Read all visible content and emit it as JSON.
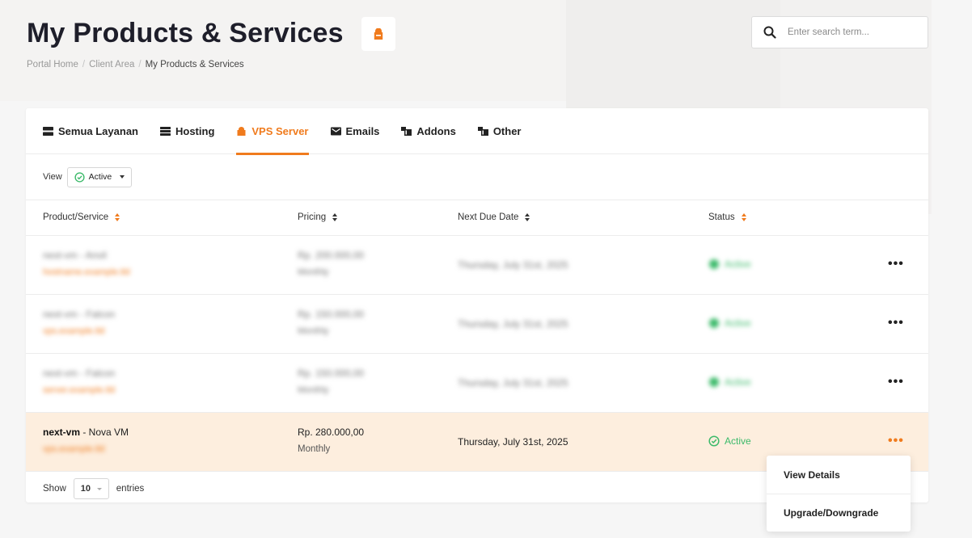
{
  "page": {
    "title": "My Products & Services",
    "accent_color": "#f07b1d",
    "status_color": "#3cba6a"
  },
  "breadcrumb": [
    {
      "label": "Portal Home"
    },
    {
      "label": "Client Area"
    },
    {
      "label": "My Products & Services"
    }
  ],
  "search": {
    "placeholder": "Enter search term..."
  },
  "tabs": [
    {
      "label": "Semua Layanan",
      "icon": "servers-icon"
    },
    {
      "label": "Hosting",
      "icon": "server-icon"
    },
    {
      "label": "VPS Server",
      "icon": "lock-icon",
      "active": true
    },
    {
      "label": "Emails",
      "icon": "envelope-icon"
    },
    {
      "label": "Addons",
      "icon": "cubes-icon"
    },
    {
      "label": "Other",
      "icon": "cubes-icon"
    }
  ],
  "view_filter": {
    "label": "View",
    "selected": "Active"
  },
  "table": {
    "columns": [
      "Product/Service",
      "Pricing",
      "Next Due Date",
      "Status"
    ],
    "rows": [
      {
        "product": "next-vm - Anvil",
        "domain": "hostname.example.tld",
        "price": "Rp. 200.000,00",
        "cycle": "Monthly",
        "due": "Thursday, July 31st, 2025",
        "status": "Active",
        "blurred": true
      },
      {
        "product": "next-vm - Falcon",
        "domain": "vps.example.tld",
        "price": "Rp. 150.000,00",
        "cycle": "Monthly",
        "due": "Thursday, July 31st, 2025",
        "status": "Active",
        "blurred": true
      },
      {
        "product": "next-vm - Falcon",
        "domain": "server.example.tld",
        "price": "Rp. 150.000,00",
        "cycle": "Monthly",
        "due": "Thursday, July 31st, 2025",
        "status": "Active",
        "blurred": true
      },
      {
        "product_bold": "next-vm",
        "product_rest": " - Nova VM",
        "domain": "vps.example.tld",
        "price": "Rp. 280.000,00",
        "cycle": "Monthly",
        "due": "Thursday, July 31st, 2025",
        "status": "Active",
        "blurred": false
      }
    ],
    "actions_label": "•••"
  },
  "footer": {
    "show_label": "Show",
    "page_length": "10",
    "entries_label": "entries"
  },
  "actions_menu": [
    {
      "label": "View Details"
    },
    {
      "label": "Upgrade/Downgrade"
    }
  ]
}
